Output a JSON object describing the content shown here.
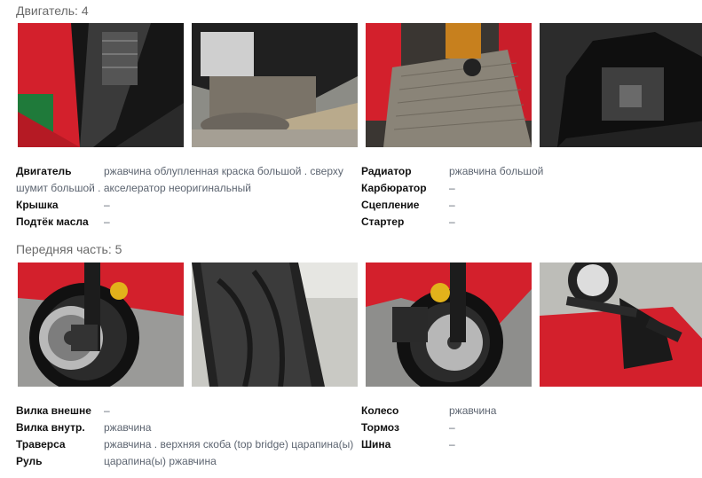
{
  "engine": {
    "title": "Двигатель: 4",
    "rows_left": [
      {
        "label": "Двигатель",
        "value": "ржавчина облупленная краска большой . сверху",
        "value_cont": "шумит большой . акселератор неоригинальный"
      },
      {
        "label": "Крышка",
        "value": "–"
      },
      {
        "label": "Подтёк масла",
        "value": "–"
      }
    ],
    "rows_right": [
      {
        "label": "Радиатор",
        "value": "ржавчина большой"
      },
      {
        "label": "Карбюратор",
        "value": "–"
      },
      {
        "label": "Сцепление",
        "value": "–"
      },
      {
        "label": "Стартер",
        "value": "–"
      }
    ]
  },
  "front": {
    "title": "Передняя часть: 5",
    "rows_left": [
      {
        "label": "Вилка внешне",
        "value": "–"
      },
      {
        "label": "Вилка внутр.",
        "value": "ржавчина"
      },
      {
        "label": "Траверса",
        "value": "ржавчина . верхняя скоба (top bridge) царапина(ы)"
      },
      {
        "label": "Руль",
        "value": "царапина(ы) ржавчина"
      }
    ],
    "rows_right": [
      {
        "label": "Колесо",
        "value": "ржавчина"
      },
      {
        "label": "Тормоз",
        "value": "–"
      },
      {
        "label": "Шина",
        "value": "–"
      }
    ]
  },
  "colors": {
    "fairing_red": "#d3202c",
    "dark": "#1e1e1e",
    "caliper": "#e2b21b",
    "grey": "#9a9a9a"
  }
}
